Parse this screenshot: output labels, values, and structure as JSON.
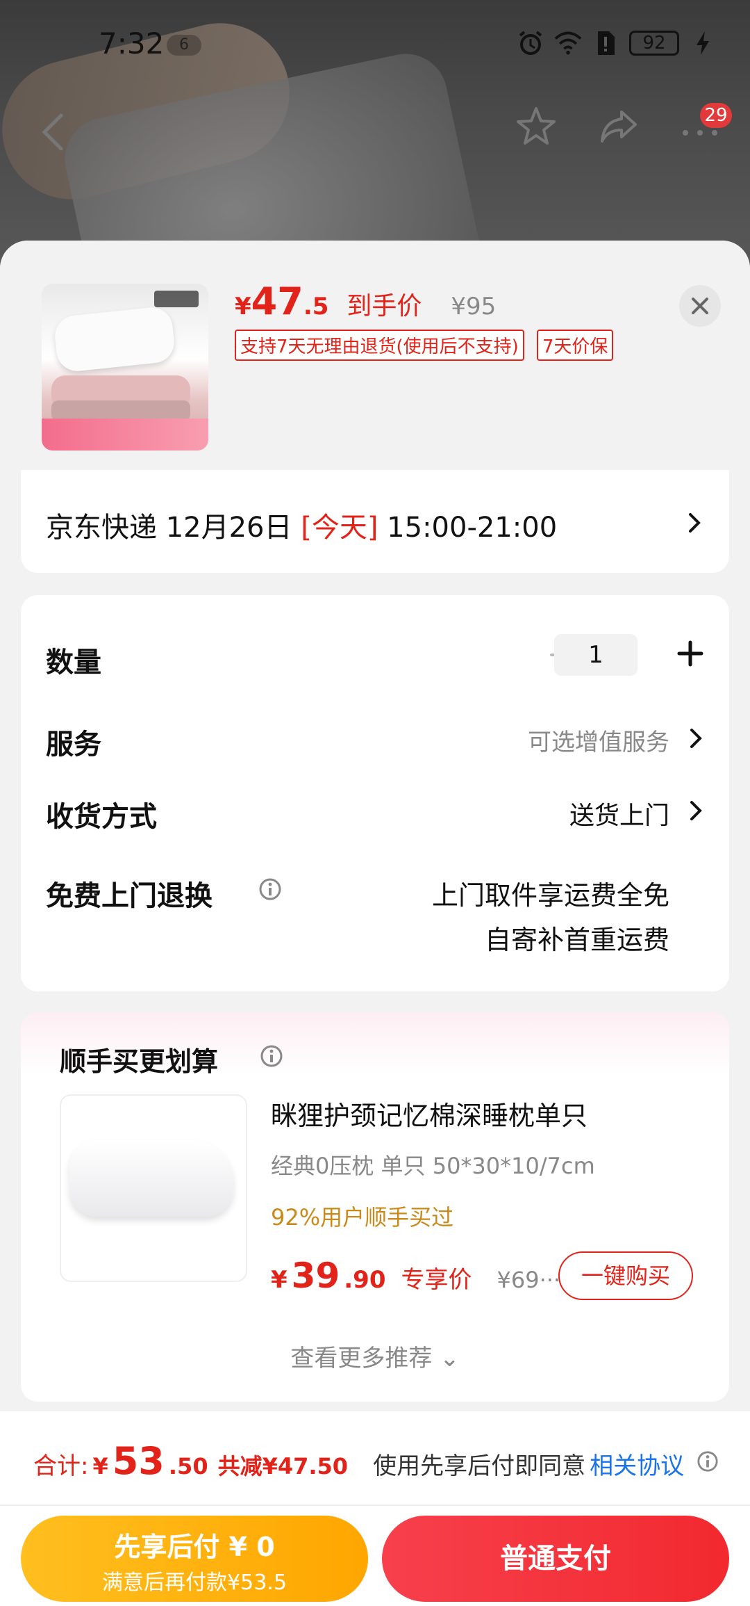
{
  "status_bar": {
    "time": "7:32",
    "notification_count": "6",
    "battery": "92"
  },
  "top_nav": {
    "more_badge": "29"
  },
  "product": {
    "price_currency": "¥",
    "price_int": "47",
    "price_dec": ".5",
    "price_label": "到手价",
    "original_price": "¥95",
    "tags": [
      "支持7天无理由退货(使用后不支持)",
      "7天价保"
    ]
  },
  "delivery": {
    "prefix": "京东快递 12月26日 ",
    "today": "[今天]",
    "time_range": " 15:00-21:00"
  },
  "options": {
    "quantity_label": "数量",
    "quantity_value": "1",
    "service_label": "服务",
    "service_value": "可选增值服务",
    "receive_label": "收货方式",
    "receive_value": "送货上门",
    "free_return_label": "免费上门退换",
    "free_return_line1": "上门取件享运费全免",
    "free_return_line2": "自寄补首重运费"
  },
  "recommend": {
    "title": "顺手买更划算",
    "item_name": "眯狸护颈记忆棉深睡枕单只",
    "item_spec": "经典0压枕 单只 50*30*10/7cm",
    "item_stat": "92%用户顺手买过",
    "price_currency": "¥",
    "price_int": "39",
    "price_dec": ".90",
    "price_label": "专享价",
    "original_price": "¥69···",
    "buy_label": "一键购买",
    "more_label": "查看更多推荐 ⌄"
  },
  "footer": {
    "total_label": "合计:",
    "total_currency": "¥",
    "total_int": "53",
    "total_dec": ".50",
    "reduce": "共减¥47.50",
    "agree_text": "使用先享后付即同意",
    "agree_link": "相关协议",
    "pay_later_title": "先享后付 ¥ 0",
    "pay_later_sub": "满意后再付款¥53.5",
    "pay_normal": "普通支付"
  },
  "colors": {
    "accent": "#e2231a",
    "link": "#1a73e8",
    "pay_later": "#ffa600",
    "pay_normal": "#f2292f"
  }
}
